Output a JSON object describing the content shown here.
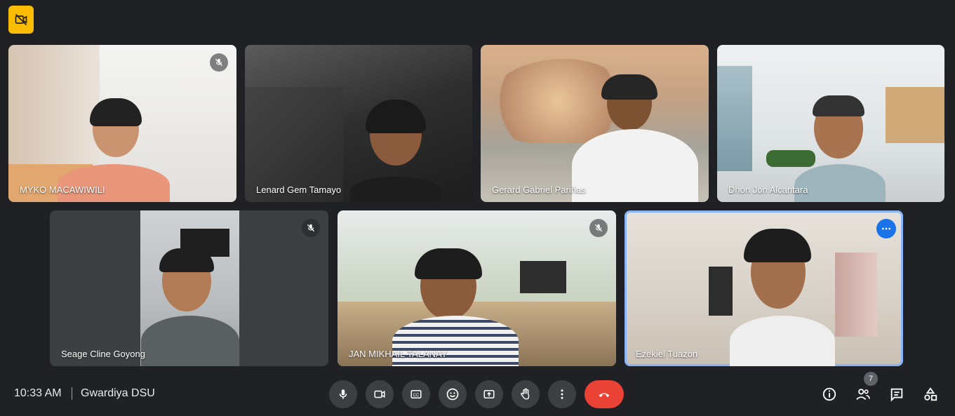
{
  "icons": {
    "corner": "camera-off-icon",
    "mic_off": "mic-off-icon",
    "more": "more-options-icon"
  },
  "participants": [
    {
      "name": "MYKO MACAWIWILI",
      "muted": true
    },
    {
      "name": "Lenard Gem Tamayo",
      "muted": false
    },
    {
      "name": "Gerard Gabriel Pariñas",
      "muted": false
    },
    {
      "name": "Dhon Jon Alcantara",
      "muted": false
    },
    {
      "name": "Seage Cline Goyong",
      "muted": true
    },
    {
      "name": "JAN MIKHAIL TALANAY",
      "muted": true
    },
    {
      "name": "Ezekiel Tuazon",
      "muted": false,
      "active_speaker": true
    }
  ],
  "footer": {
    "time": "10:33 AM",
    "meeting_name": "Gwardiya DSU"
  },
  "controls": [
    {
      "icon": "microphone-icon"
    },
    {
      "icon": "camera-icon"
    },
    {
      "icon": "captions-icon"
    },
    {
      "icon": "emoji-icon"
    },
    {
      "icon": "present-screen-icon"
    },
    {
      "icon": "raise-hand-icon"
    },
    {
      "icon": "more-options-icon"
    },
    {
      "icon": "end-call-icon"
    }
  ],
  "right_controls": {
    "participant_count": "7",
    "icons": [
      "info-icon",
      "people-icon",
      "chat-icon",
      "activities-icon"
    ]
  },
  "colors": {
    "background": "#202124",
    "end_call": "#ea4335",
    "active_outline": "#8ab4f8",
    "badge": "#fbbc04"
  }
}
